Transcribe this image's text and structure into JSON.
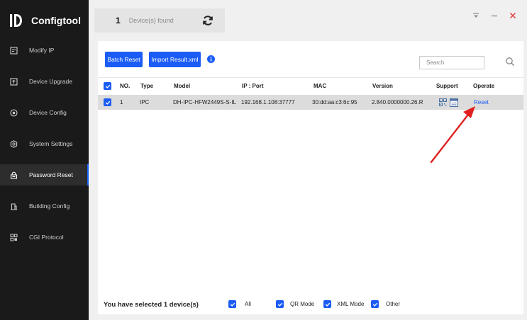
{
  "app": {
    "title": "Configtool",
    "window_controls": [
      "minimize-to-tray",
      "minimize",
      "close"
    ]
  },
  "topbar": {
    "device_count": "1",
    "devices_found_label": "Device(s) found"
  },
  "sidebar": {
    "items": [
      {
        "label": "Modify IP",
        "icon": "edit-icon"
      },
      {
        "label": "Device Upgrade",
        "icon": "upload-icon"
      },
      {
        "label": "Device Config",
        "icon": "target-icon"
      },
      {
        "label": "System Settings",
        "icon": "settings-icon"
      },
      {
        "label": "Password Reset",
        "icon": "lock-icon",
        "active": true
      },
      {
        "label": "Building Config",
        "icon": "building-icon"
      },
      {
        "label": "CGI Protocol",
        "icon": "grid-icon"
      }
    ]
  },
  "toolbar": {
    "batch_reset_label": "Batch Reset",
    "import_result_label": "Import Result.xml",
    "search_placeholder": "Search"
  },
  "table": {
    "headers": {
      "no": "NO.",
      "type": "Type",
      "model": "Model",
      "ip_port": "IP : Port",
      "mac": "MAC",
      "version": "Version",
      "support": "Support",
      "operate": "Operate"
    },
    "rows": [
      {
        "checked": true,
        "no": "1",
        "type": "IPC",
        "model": "DH-IPC-HFW2449S-S-IL",
        "ip_port": "192.168.1.108:37777",
        "mac": "30:dd:aa:c3:6c:95",
        "version": "2.840.0000000.26.R",
        "support": [
          "qr-code-icon",
          "xml-file-icon"
        ],
        "operate": "Reset"
      }
    ]
  },
  "footer": {
    "selected_text": "You have selected 1  device(s)",
    "filters": [
      {
        "label": "All",
        "checked": true
      },
      {
        "label": "QR Mode",
        "checked": true
      },
      {
        "label": "XML Mode",
        "checked": true
      },
      {
        "label": "Other",
        "checked": true
      }
    ]
  },
  "colors": {
    "accent": "#1a5cf5",
    "sidebar_bg": "#1a1a1a",
    "annotation_arrow": "#e02020",
    "close_icon": "#e0403a"
  }
}
